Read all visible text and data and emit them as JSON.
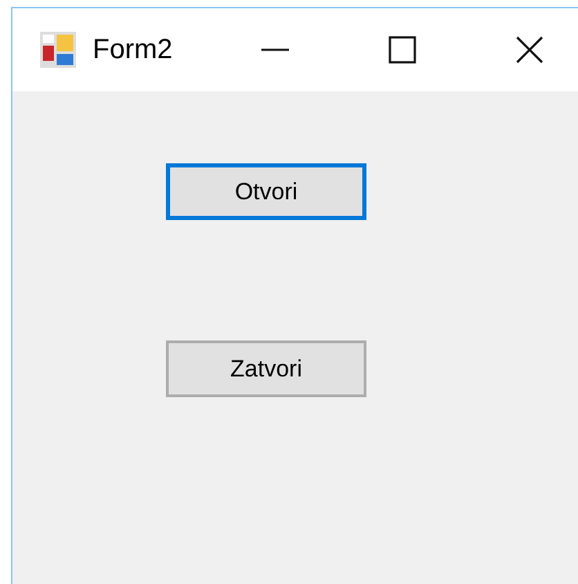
{
  "window": {
    "title": "Form2"
  },
  "buttons": [
    {
      "label": "Otvori",
      "focused": true
    },
    {
      "label": "Zatvori",
      "focused": false
    }
  ]
}
